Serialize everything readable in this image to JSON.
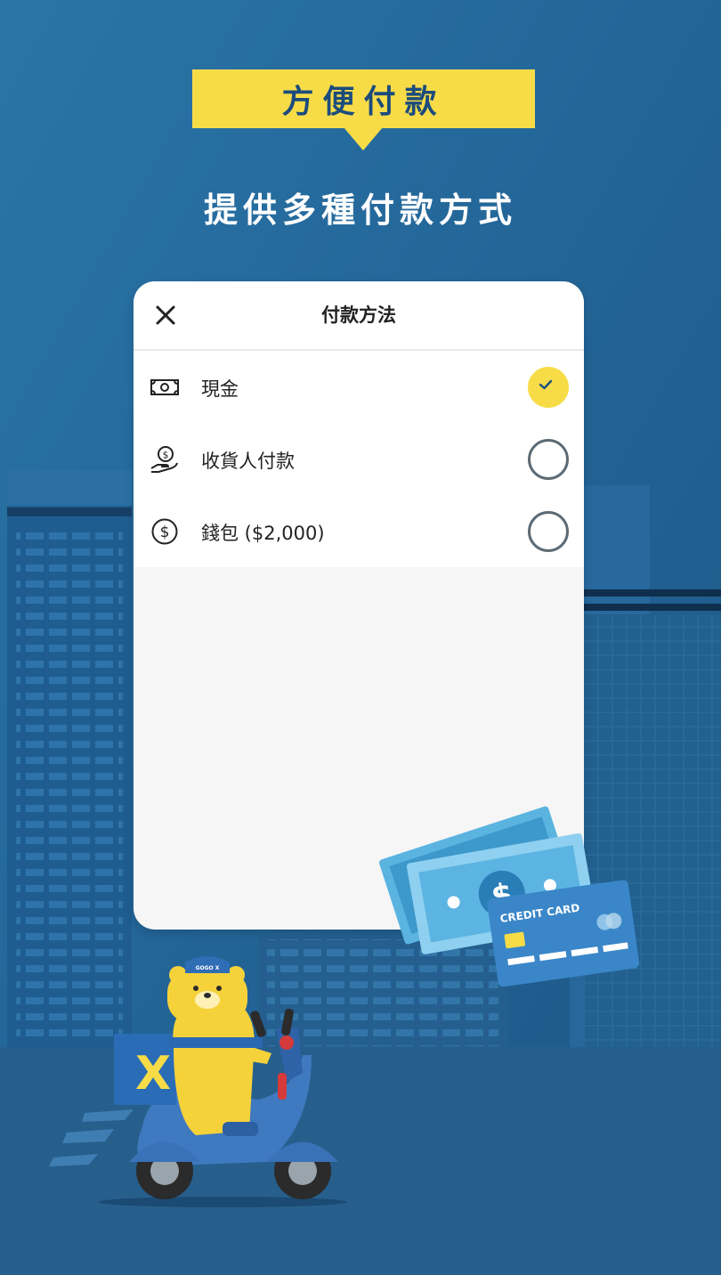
{
  "banner": {
    "title": "方便付款"
  },
  "subtitle": "提供多種付款方式",
  "dialog": {
    "title": "付款方法",
    "close_icon": "close-icon",
    "options": [
      {
        "label": "現金",
        "icon": "cash-icon",
        "selected": true
      },
      {
        "label": "收貨人付款",
        "icon": "hand-coin-icon",
        "selected": false
      },
      {
        "label": "錢包 ($2,000)",
        "icon": "dollar-circle-icon",
        "selected": false
      }
    ]
  },
  "illustration": {
    "card_text": "CREDIT CARD",
    "box_letter": "X",
    "cap_text": "GOGO X"
  },
  "colors": {
    "background": "#1f5a8a",
    "accent_yellow": "#f7dc48",
    "banner_text": "#1c4c7c"
  }
}
